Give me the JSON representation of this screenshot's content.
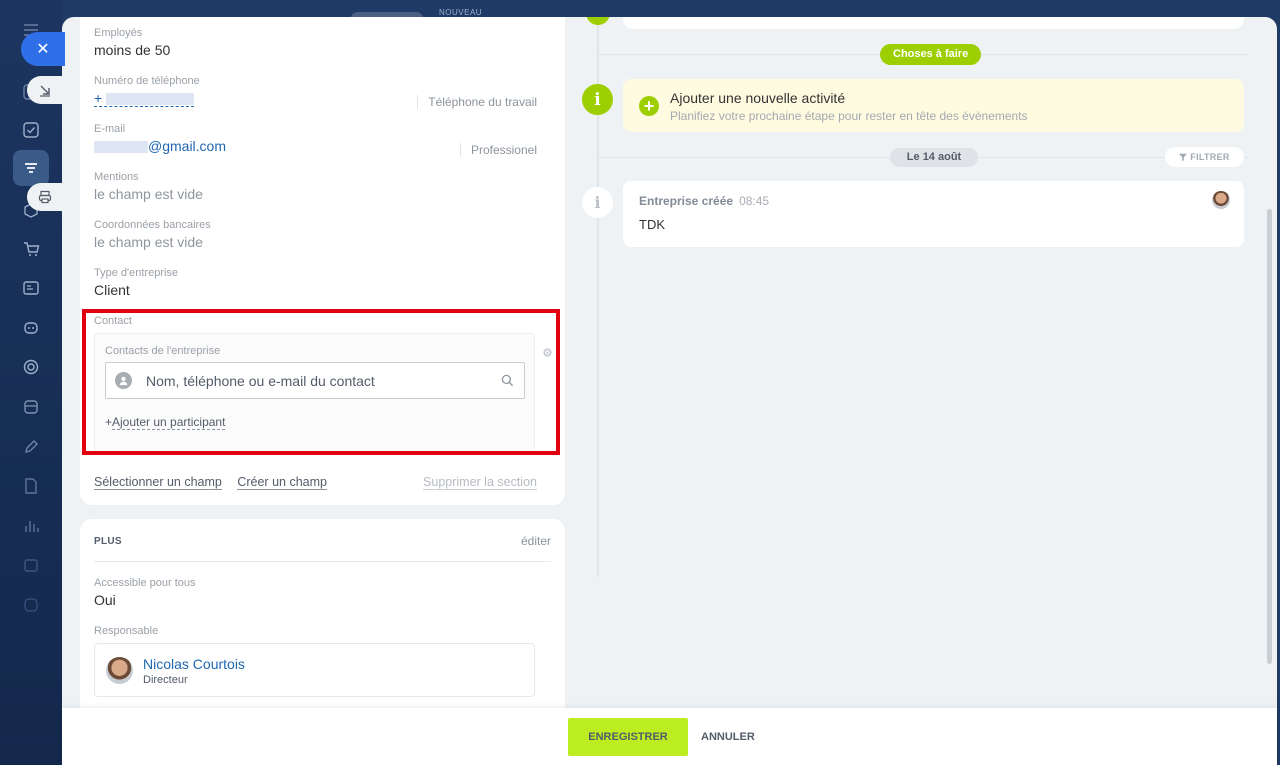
{
  "header": {
    "ghost_badge": "NOUVEAU"
  },
  "fields": {
    "employees": {
      "label": "Employés",
      "value": "moins de 50"
    },
    "phone": {
      "label": "Numéro de téléphone",
      "prefix": "+",
      "type": "Téléphone du travail"
    },
    "email": {
      "label": "E-mail",
      "domain": "@gmail.com",
      "type": "Professionel"
    },
    "mentions": {
      "label": "Mentions",
      "value": "le champ est vide"
    },
    "bank": {
      "label": "Coordonnées bancaires",
      "value": "le champ est vide"
    },
    "company_type": {
      "label": "Type d'entreprise",
      "value": "Client"
    }
  },
  "contact": {
    "section_label": "Contact",
    "box_label": "Contacts de l'entreprise",
    "search_placeholder": "Nom, téléphone ou e-mail du contact",
    "add_participant": "Ajouter un participant",
    "add_prefix": "+"
  },
  "section_actions": {
    "select_field": "Sélectionner un champ",
    "create_field": "Créer un champ",
    "delete_section": "Supprimer la section"
  },
  "plus_section": {
    "title": "PLUS",
    "edit": "éditer",
    "access_label": "Accessible pour tous",
    "access_value": "Oui",
    "responsible_label": "Responsable",
    "responsible_name": "Nicolas Courtois",
    "responsible_role": "Directeur"
  },
  "timeline": {
    "todo_pill": "Choses à faire",
    "add_activity_title": "Ajouter une nouvelle activité",
    "add_activity_sub": "Planifiez votre prochaine étape pour rester en tête des évènements",
    "date_pill": "Le 14 août",
    "filter": "FILTRER",
    "event_title": "Entreprise créée",
    "event_time": "08:45",
    "event_body": "TDK"
  },
  "footer": {
    "save": "ENREGISTRER",
    "cancel": "ANNULER"
  },
  "colors": {
    "accent_green": "#9dcf00",
    "save_button": "#bbed21",
    "highlight": "#e0000f",
    "close_button": "#2f6fe8"
  },
  "icons": [
    "menu-icon",
    "close-icon",
    "import-icon",
    "task-check-icon",
    "funnel-icon",
    "print-icon",
    "cart-icon",
    "contact-card-icon",
    "robot-icon",
    "target-icon",
    "archive-icon",
    "pen-icon",
    "document-icon",
    "bar-chart-icon",
    "calendar-icon",
    "disk-icon",
    "search-icon",
    "gear-icon",
    "filter-icon",
    "info-icon",
    "plus-icon"
  ]
}
